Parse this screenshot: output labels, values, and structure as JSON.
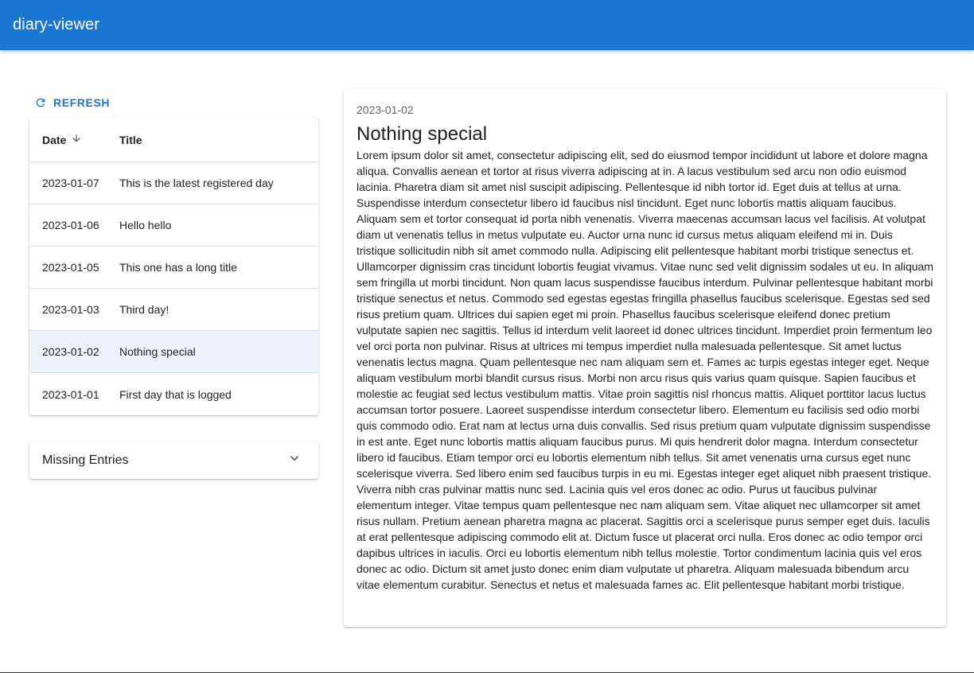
{
  "app": {
    "title": "diary-viewer"
  },
  "toolbar": {
    "refresh_label": "REFRESH"
  },
  "table": {
    "columns": {
      "date": "Date",
      "title": "Title"
    },
    "sort": "descending",
    "rows": [
      {
        "date": "2023-01-07",
        "title": "This is the latest registered day"
      },
      {
        "date": "2023-01-06",
        "title": "Hello hello"
      },
      {
        "date": "2023-01-05",
        "title": "This one has a long title"
      },
      {
        "date": "2023-01-03",
        "title": "Third day!"
      },
      {
        "date": "2023-01-02",
        "title": "Nothing special",
        "selected": true
      },
      {
        "date": "2023-01-01",
        "title": "First day that is logged"
      }
    ]
  },
  "missing": {
    "label": "Missing Entries"
  },
  "entry": {
    "date": "2023-01-02",
    "title": "Nothing special",
    "body": "Lorem ipsum dolor sit amet, consectetur adipiscing elit, sed do eiusmod tempor incididunt ut labore et dolore magna aliqua. Convallis aenean et tortor at risus viverra adipiscing at in. A lacus vestibulum sed arcu non odio euismod lacinia. Pharetra diam sit amet nisl suscipit adipiscing. Pellentesque id nibh tortor id. Eget duis at tellus at urna. Suspendisse interdum consectetur libero id faucibus nisl tincidunt. Eget nunc lobortis mattis aliquam faucibus. Aliquam sem et tortor consequat id porta nibh venenatis. Viverra maecenas accumsan lacus vel facilisis. At volutpat diam ut venenatis tellus in metus vulputate eu. Auctor urna nunc id cursus metus aliquam eleifend mi in. Duis tristique sollicitudin nibh sit amet commodo nulla. Adipiscing elit pellentesque habitant morbi tristique senectus et. Ullamcorper dignissim cras tincidunt lobortis feugiat vivamus. Vitae nunc sed velit dignissim sodales ut eu. In aliquam sem fringilla ut morbi tincidunt. Non quam lacus suspendisse faucibus interdum. Pulvinar pellentesque habitant morbi tristique senectus et netus. Commodo sed egestas egestas fringilla phasellus faucibus scelerisque. Egestas sed sed risus pretium quam. Ultrices dui sapien eget mi proin. Phasellus faucibus scelerisque eleifend donec pretium vulputate sapien nec sagittis. Tellus id interdum velit laoreet id donec ultrices tincidunt. Imperdiet proin fermentum leo vel orci porta non pulvinar. Risus at ultrices mi tempus imperdiet nulla malesuada pellentesque. Sit amet luctus venenatis lectus magna. Quam pellentesque nec nam aliquam sem et. Fames ac turpis egestas integer eget. Neque aliquam vestibulum morbi blandit cursus risus. Morbi non arcu risus quis varius quam quisque. Sapien faucibus et molestie ac feugiat sed lectus vestibulum mattis. Vitae proin sagittis nisl rhoncus mattis. Aliquet porttitor lacus luctus accumsan tortor posuere. Laoreet suspendisse interdum consectetur libero. Elementum eu facilisis sed odio morbi quis commodo odio. Erat nam at lectus urna duis convallis. Sed risus pretium quam vulputate dignissim suspendisse in est ante. Eget nunc lobortis mattis aliquam faucibus purus. Mi quis hendrerit dolor magna. Interdum consectetur libero id faucibus. Etiam tempor orci eu lobortis elementum nibh tellus. Sit amet venenatis urna cursus eget nunc scelerisque viverra. Sed libero enim sed faucibus turpis in eu mi. Egestas integer eget aliquet nibh praesent tristique. Viverra nibh cras pulvinar mattis nunc sed. Lacinia quis vel eros donec ac odio. Purus ut faucibus pulvinar elementum integer. Vitae tempus quam pellentesque nec nam aliquam sem. Vitae aliquet nec ullamcorper sit amet risus nullam. Pretium aenean pharetra magna ac placerat. Sagittis orci a scelerisque purus semper eget duis. Iaculis at erat pellentesque adipiscing commodo elit at. Dictum fusce ut placerat orci nulla. Eros donec ac odio tempor orci dapibus ultrices in iaculis. Orci eu lobortis elementum nibh tellus molestie. Tortor condimentum lacinia quis vel eros donec ac odio. Dictum sit amet justo donec enim diam vulputate ut pharetra. Aliquam malesuada bibendum arcu vitae elementum curabitur. Senectus et netus et malesuada fames ac. Elit pellentesque habitant morbi tristique."
  },
  "icons": {
    "refresh": "refresh-icon",
    "sort": "arrow-down-icon",
    "expand": "chevron-down-icon"
  },
  "colors": {
    "primary": "#1976d2",
    "selected_row": "#edf3fc"
  }
}
